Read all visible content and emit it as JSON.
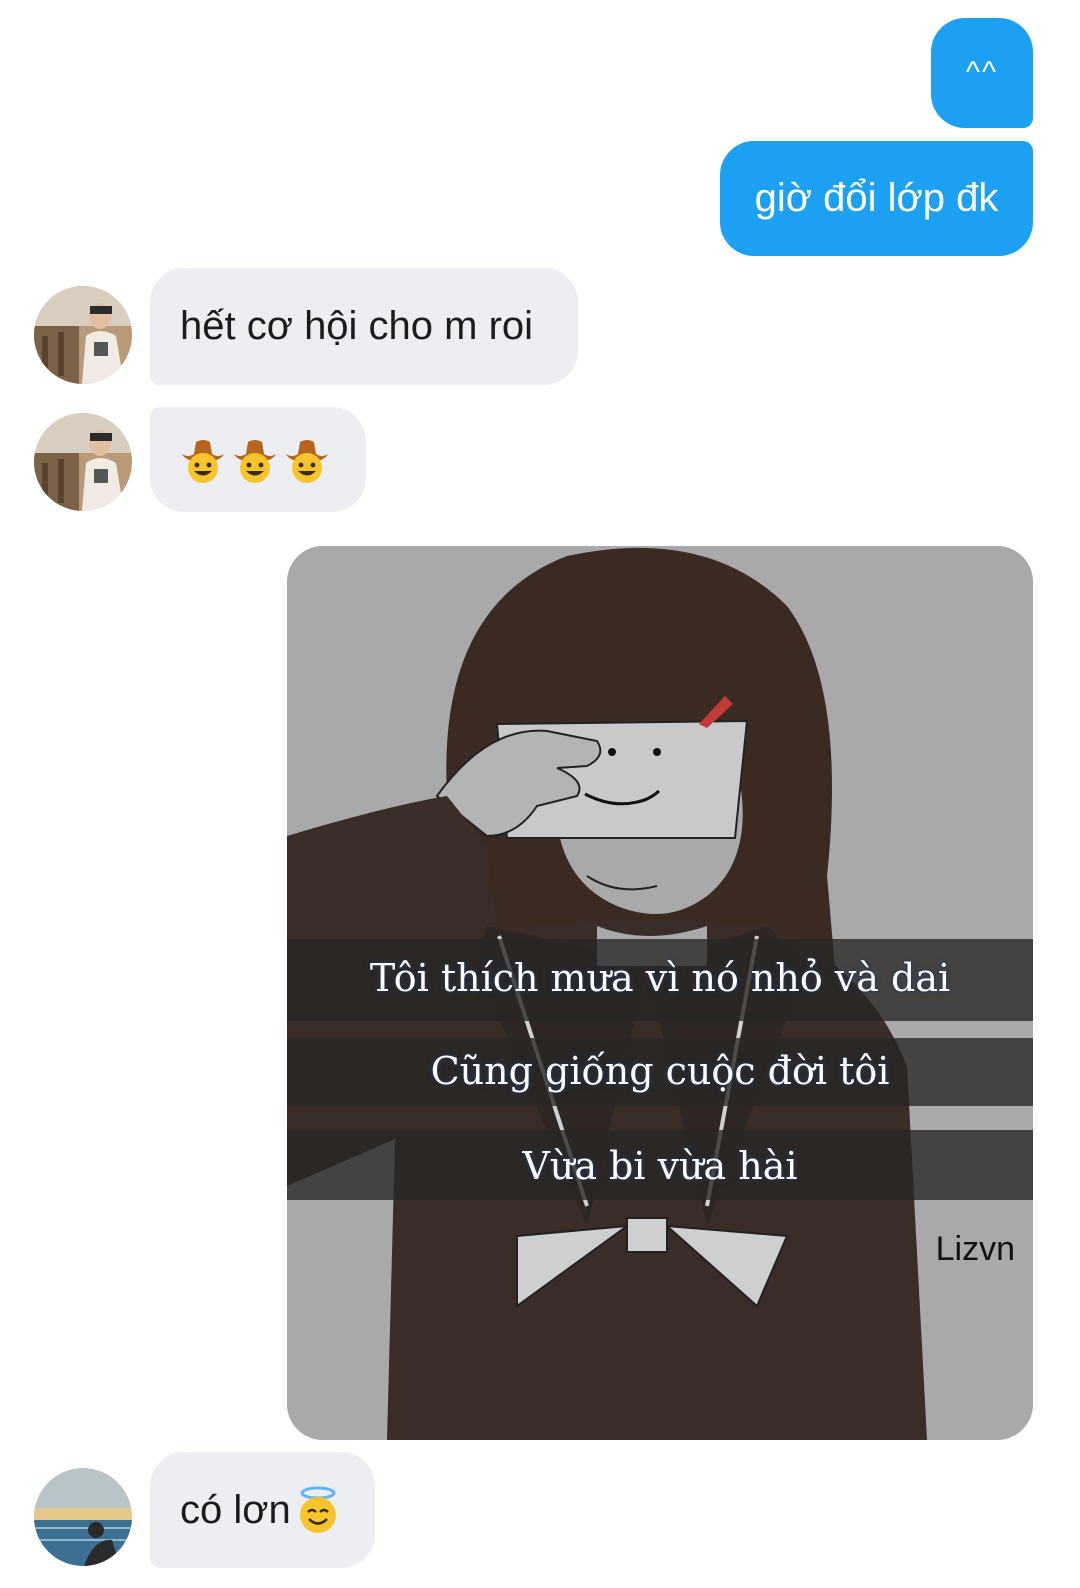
{
  "messages": [
    {
      "id": "m1",
      "direction": "out",
      "text": "^^"
    },
    {
      "id": "m2",
      "direction": "out",
      "text": "giờ đổi lớp đk"
    },
    {
      "id": "m3",
      "direction": "in",
      "text": "hết cơ hội cho m roi"
    },
    {
      "id": "m4",
      "direction": "in",
      "emoji": [
        "cowboy-face",
        "cowboy-face",
        "cowboy-face"
      ]
    },
    {
      "id": "m5",
      "direction": "out",
      "type": "image",
      "image": {
        "captions": [
          "Tôi thích mưa vì nó nhỏ và dai",
          "Cũng giống cuộc đời tôi",
          "Vừa bi vừa hài"
        ],
        "watermark": "Lizvn"
      }
    },
    {
      "id": "m6",
      "direction": "in",
      "text": "có lơn",
      "emoji": [
        "smiling-face-with-halo"
      ]
    }
  ],
  "colors": {
    "outgoing_bubble": "#1ba0f2",
    "incoming_bubble": "#edeef2",
    "background": "#ffffff"
  }
}
